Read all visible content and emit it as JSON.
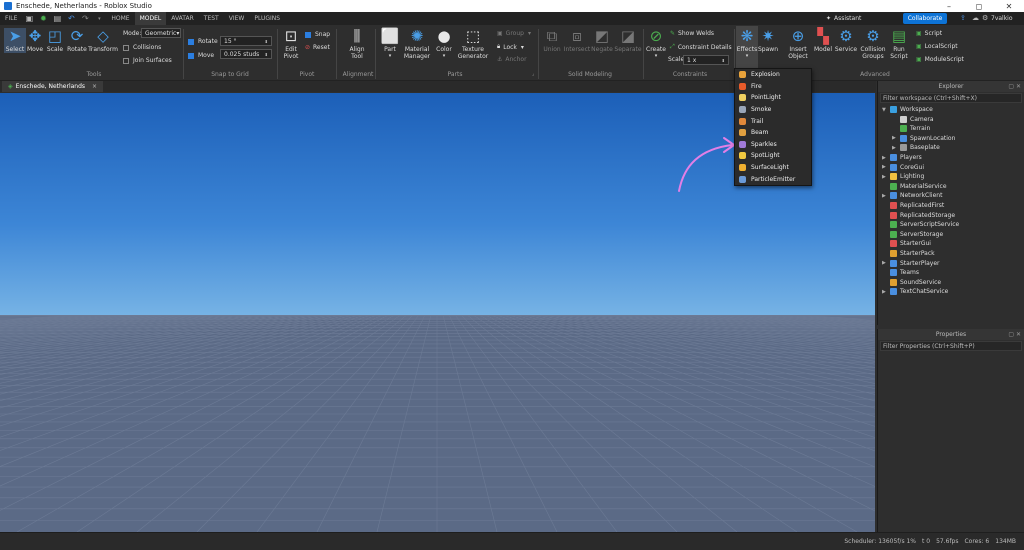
{
  "window": {
    "title": "Enschede, Netherlands - Roblox Studio",
    "minimize": "–",
    "maximize": "◻",
    "close": "✕"
  },
  "menu": {
    "file": "FILE",
    "tabs": [
      "HOME",
      "MODEL",
      "AVATAR",
      "TEST",
      "VIEW",
      "PLUGINS"
    ],
    "active_tab": "MODEL",
    "assistant": "Assistant",
    "collaborate": "Collaborate",
    "user": "7valkio"
  },
  "ribbon": {
    "tools": {
      "select": "Select",
      "move": "Move",
      "scale": "Scale",
      "rotate": "Rotate",
      "transform": "Transform",
      "mode_label": "Mode:",
      "mode_value": "Geometric",
      "collisions": "Collisions",
      "join_surfaces": "Join Surfaces",
      "group": "Tools"
    },
    "snap": {
      "rotate_label": "Rotate",
      "rotate_value": "15 °",
      "move_label": "Move",
      "move_value": "0.025 studs",
      "group": "Snap to Grid"
    },
    "pivot": {
      "edit_pivot": "Edit Pivot",
      "snap": "Snap",
      "reset": "Reset",
      "group": "Pivot"
    },
    "alignment": {
      "align_tool": "Align Tool",
      "group": "Alignment"
    },
    "parts": {
      "part": "Part",
      "material_manager": "Material Manager",
      "color": "Color",
      "texture_generator": "Texture Generator",
      "group_btn": "Group",
      "lock": "Lock",
      "anchor": "Anchor",
      "group": "Parts"
    },
    "solid": {
      "union": "Union",
      "intersect": "Intersect",
      "negate": "Negate",
      "separate": "Separate",
      "group": "Solid Modeling"
    },
    "constraints": {
      "create": "Create",
      "show_welds": "Show Welds",
      "constraint_details": "Constraint Details",
      "scale": "Scale",
      "scale_value": "1 x",
      "group": "Constraints"
    },
    "advanced": {
      "effects": "Effects",
      "spawn": "Spawn",
      "insert_object": "Insert Object",
      "model": "Model",
      "service": "Service",
      "collision_groups": "Collision Groups",
      "run_script": "Run Script",
      "script": "Script",
      "local_script": "LocalScript",
      "module_script": "ModuleScript",
      "group": "Advanced"
    }
  },
  "document_tab": {
    "label": "Enschede, Netherlands",
    "close": "×"
  },
  "effects_menu": {
    "items": [
      {
        "label": "Explosion",
        "color": "#e8a23a"
      },
      {
        "label": "Fire",
        "color": "#e85b2a"
      },
      {
        "label": "PointLight",
        "color": "#f0d060"
      },
      {
        "label": "Smoke",
        "color": "#9aa6b8"
      },
      {
        "label": "Trail",
        "color": "#e0883a"
      },
      {
        "label": "Beam",
        "color": "#e0a040"
      },
      {
        "label": "Sparkles",
        "color": "#a07ad8"
      },
      {
        "label": "SpotLight",
        "color": "#f0c840"
      },
      {
        "label": "SurfaceLight",
        "color": "#f0b030"
      },
      {
        "label": "ParticleEmitter",
        "color": "#6a9ad8"
      }
    ]
  },
  "explorer": {
    "title": "Explorer",
    "filter": "Filter workspace (Ctrl+Shift+X)",
    "items": [
      {
        "label": "Workspace",
        "depth": 0,
        "arrow": "▼",
        "color": "#3aa0e0"
      },
      {
        "label": "Camera",
        "depth": 1,
        "arrow": "",
        "color": "#cfcfcf"
      },
      {
        "label": "Terrain",
        "depth": 1,
        "arrow": "",
        "color": "#4caf50"
      },
      {
        "label": "SpawnLocation",
        "depth": 1,
        "arrow": "▶",
        "color": "#4a8fe0"
      },
      {
        "label": "Baseplate",
        "depth": 1,
        "arrow": "▶",
        "color": "#9a9a9a"
      },
      {
        "label": "Players",
        "depth": 0,
        "arrow": "▶",
        "color": "#4a8fe0"
      },
      {
        "label": "CoreGui",
        "depth": 0,
        "arrow": "▶",
        "color": "#4a8fe0"
      },
      {
        "label": "Lighting",
        "depth": 0,
        "arrow": "▶",
        "color": "#f0c040"
      },
      {
        "label": "MaterialService",
        "depth": 0,
        "arrow": "",
        "color": "#4caf50"
      },
      {
        "label": "NetworkClient",
        "depth": 0,
        "arrow": "▶",
        "color": "#4a8fe0"
      },
      {
        "label": "ReplicatedFirst",
        "depth": 0,
        "arrow": "",
        "color": "#e05050"
      },
      {
        "label": "ReplicatedStorage",
        "depth": 0,
        "arrow": "",
        "color": "#e05050"
      },
      {
        "label": "ServerScriptService",
        "depth": 0,
        "arrow": "",
        "color": "#4caf50"
      },
      {
        "label": "ServerStorage",
        "depth": 0,
        "arrow": "",
        "color": "#4caf50"
      },
      {
        "label": "StarterGui",
        "depth": 0,
        "arrow": "",
        "color": "#e05050"
      },
      {
        "label": "StarterPack",
        "depth": 0,
        "arrow": "",
        "color": "#e0a030"
      },
      {
        "label": "StarterPlayer",
        "depth": 0,
        "arrow": "▶",
        "color": "#4a8fe0"
      },
      {
        "label": "Teams",
        "depth": 0,
        "arrow": "",
        "color": "#4a8fe0"
      },
      {
        "label": "SoundService",
        "depth": 0,
        "arrow": "",
        "color": "#e0a030"
      },
      {
        "label": "TextChatService",
        "depth": 0,
        "arrow": "▶",
        "color": "#4a8fe0"
      }
    ]
  },
  "properties": {
    "title": "Properties",
    "filter": "Filter Properties (Ctrl+Shift+P)"
  },
  "status": {
    "scheduler": "Scheduler: 13605f/s 1%",
    "t": "t 0",
    "fps": "57.6fps",
    "cores": "Cores: 6",
    "memory": "134MB"
  },
  "colors": {
    "accent": "#0d73d6",
    "annotation_arrow": "#e27fe6"
  }
}
